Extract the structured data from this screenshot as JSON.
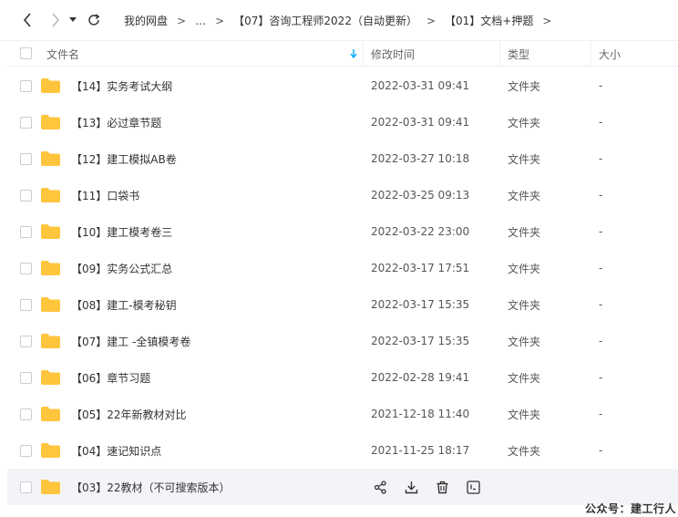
{
  "breadcrumb": {
    "items": [
      "我的网盘",
      "…",
      "【07】咨询工程师2022（自动更新）",
      "【01】文档+押题"
    ],
    "separator": ">"
  },
  "table": {
    "headers": {
      "name": "文件名",
      "modified": "修改时间",
      "type": "类型",
      "size": "大小"
    },
    "rows": [
      {
        "name": "【14】实务考试大纲",
        "modified": "2022-03-31 09:41",
        "type": "文件夹",
        "size": "-"
      },
      {
        "name": "【13】必过章节题",
        "modified": "2022-03-31 09:41",
        "type": "文件夹",
        "size": "-"
      },
      {
        "name": "【12】建工模拟AB卷",
        "modified": "2022-03-27 10:18",
        "type": "文件夹",
        "size": "-"
      },
      {
        "name": "【11】口袋书",
        "modified": "2022-03-25 09:13",
        "type": "文件夹",
        "size": "-"
      },
      {
        "name": "【10】建工模考卷三",
        "modified": "2022-03-22 23:00",
        "type": "文件夹",
        "size": "-"
      },
      {
        "name": "【09】实务公式汇总",
        "modified": "2022-03-17 17:51",
        "type": "文件夹",
        "size": "-"
      },
      {
        "name": "【08】建工-模考秘钥",
        "modified": "2022-03-17 15:35",
        "type": "文件夹",
        "size": "-"
      },
      {
        "name": "【07】建工 -全镇模考卷",
        "modified": "2022-03-17 15:35",
        "type": "文件夹",
        "size": "-"
      },
      {
        "name": "【06】章节习题",
        "modified": "2022-02-28 19:41",
        "type": "文件夹",
        "size": "-"
      },
      {
        "name": "【05】22年新教材对比",
        "modified": "2021-12-18 11:40",
        "type": "文件夹",
        "size": "-"
      },
      {
        "name": "【04】速记知识点",
        "modified": "2021-11-25 18:17",
        "type": "文件夹",
        "size": "-"
      },
      {
        "name": "【03】22教材（不可搜索版本）",
        "modified": "",
        "type": "",
        "size": ""
      }
    ]
  },
  "watermark": "公众号：建工行人",
  "colors": {
    "folder": "#FFC53D",
    "sort_arrow": "#06A7FF",
    "hover_row": "#F3F4F7"
  },
  "icons": [
    "back-icon",
    "forward-icon",
    "dropdown-icon",
    "refresh-icon",
    "sort-down-icon",
    "folder-icon",
    "share-icon",
    "download-icon",
    "delete-icon",
    "more-icon"
  ]
}
